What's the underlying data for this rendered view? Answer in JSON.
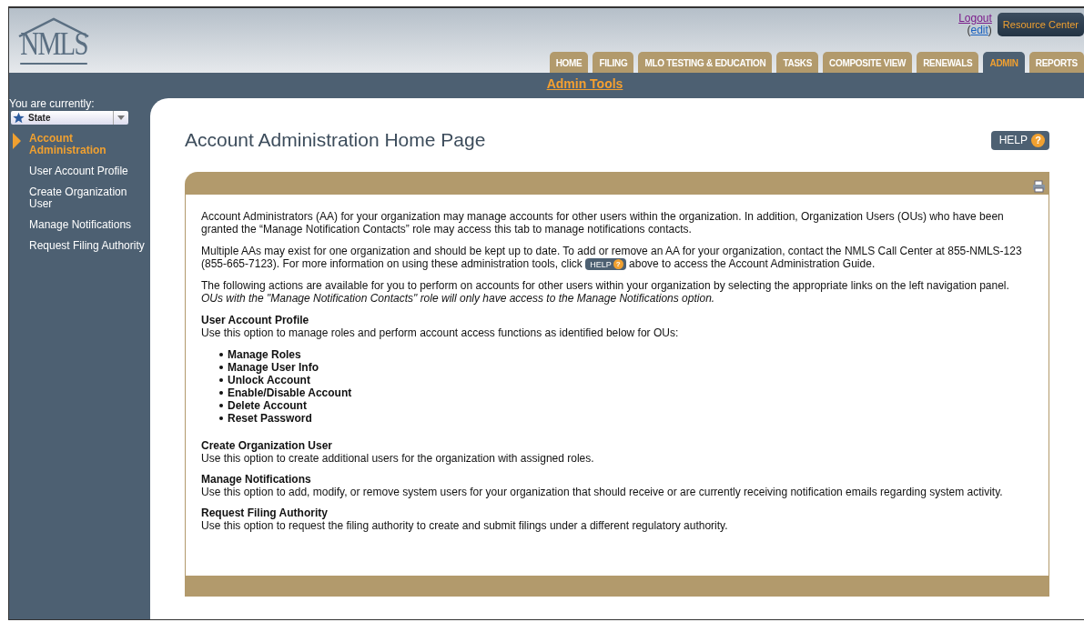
{
  "header": {
    "logo": "NMLS",
    "logout": "Logout",
    "edit_open": "(",
    "edit": "edit",
    "edit_close": ")",
    "resource_center": "Resource Center"
  },
  "tabs": [
    {
      "label": "HOME",
      "selected": false
    },
    {
      "label": "FILING",
      "selected": false
    },
    {
      "label": "MLO TESTING & EDUCATION",
      "selected": false
    },
    {
      "label": "TASKS",
      "selected": false
    },
    {
      "label": "COMPOSITE VIEW",
      "selected": false
    },
    {
      "label": "RENEWALS",
      "selected": false
    },
    {
      "label": "ADMIN",
      "selected": true
    },
    {
      "label": "REPORTS",
      "selected": false
    }
  ],
  "subnav": {
    "title": "Admin Tools"
  },
  "sidebar": {
    "context_label": "You are currently:",
    "context_value": "State",
    "items": [
      {
        "label": "Account Administration",
        "selected": true
      },
      {
        "label": "User Account Profile",
        "selected": false
      },
      {
        "label": "Create Organization User",
        "selected": false
      },
      {
        "label": "Manage Notifications",
        "selected": false
      },
      {
        "label": "Request Filing Authority",
        "selected": false
      }
    ]
  },
  "page": {
    "title": "Account Administration Home Page",
    "help": {
      "label": "HELP",
      "mark": "?"
    },
    "intro": "Account Administrators (AA) for your organization may manage accounts for other users within the organization. In addition, Organization Users (OUs) who have been granted the “Manage Notification Contacts” role may access this tab to manage notifications contacts.",
    "multiple_before": "Multiple AAs may exist for one organization and should be kept up to date. To add or remove an AA for your organization, contact the NMLS Call Center at 855-NMLS-123 (855-665-7123). For more information on using these administration tools, click",
    "multiple_help": {
      "label": "HELP",
      "mark": "?"
    },
    "multiple_after": "above to access the Account Administration Guide.",
    "actions_text": "The following actions are available for you to perform on accounts for other users within your organization by selecting the appropriate links on the left navigation panel.",
    "actions_note": "OUs with the \"Manage Notification Contacts\" role will only have access to the Manage Notifications option.",
    "sections": [
      {
        "heading": "User Account Profile",
        "text": "Use this option to manage roles and perform account access functions as identified below for OUs:",
        "bullets": [
          "Manage Roles",
          "Manage User Info",
          "Unlock Account",
          "Enable/Disable Account",
          "Delete Account",
          "Reset Password"
        ]
      },
      {
        "heading": "Create Organization User",
        "text": "Use this option to create additional users for the organization with assigned roles."
      },
      {
        "heading": "Manage Notifications",
        "text": "Use this option to add, modify, or remove system users for your organization that should receive or are currently receiving notification emails regarding system activity."
      },
      {
        "heading": "Request Filing Authority",
        "text": "Use this option to request the filing authority to create and submit filings under a different regulatory authority."
      }
    ]
  }
}
